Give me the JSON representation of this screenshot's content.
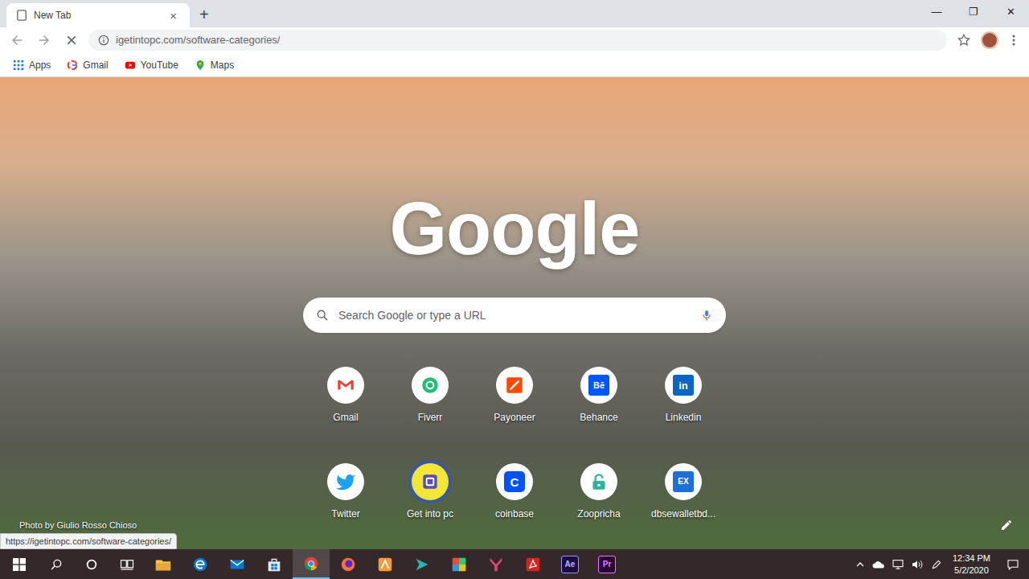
{
  "browser": {
    "tabs": [
      {
        "title": "New Tab",
        "selected": true
      }
    ],
    "tab_close": "×",
    "new_tab": "+",
    "window_controls": [
      "—",
      "❐",
      "✕"
    ]
  },
  "toolbar": {
    "url": "igetintopc.com/software-categories/",
    "loading": true
  },
  "bookmarks": [
    {
      "label": "Apps",
      "kind": "apps"
    },
    {
      "label": "Gmail",
      "kind": "google"
    },
    {
      "label": "YouTube",
      "kind": "youtube"
    },
    {
      "label": "Maps",
      "kind": "maps"
    }
  ],
  "ntp": {
    "logo": "Google",
    "search_placeholder": "Search Google or type a URL",
    "shortcuts": [
      {
        "label": "Gmail",
        "kind": "gmail",
        "hovered": false
      },
      {
        "label": "Fiverr",
        "kind": "fiverr",
        "hovered": false
      },
      {
        "label": "Payoneer",
        "kind": "payoneer",
        "hovered": false
      },
      {
        "label": "Behance",
        "kind": "behance",
        "glyph": "Bē",
        "hovered": false
      },
      {
        "label": "Linkedin",
        "kind": "linkedin",
        "glyph": "in",
        "hovered": false
      },
      {
        "label": "Twitter",
        "kind": "twitter",
        "hovered": false
      },
      {
        "label": "Get into pc",
        "kind": "getintopc",
        "hovered": true
      },
      {
        "label": "coinbase",
        "kind": "coinbase",
        "glyph": "C",
        "hovered": false
      },
      {
        "label": "Zoopricha",
        "kind": "lock",
        "hovered": false
      },
      {
        "label": "dbsewalletbd...",
        "kind": "ex",
        "glyph": "EX",
        "hovered": false
      }
    ],
    "attribution": "Photo by Giulio Rosso Chioso"
  },
  "status_url": "https://igetintopc.com/software-categories/",
  "taskbar": {
    "apps": [
      {
        "kind": "explorer",
        "active": false
      },
      {
        "kind": "edge",
        "active": false
      },
      {
        "kind": "mail",
        "active": false
      },
      {
        "kind": "store",
        "active": false
      },
      {
        "kind": "chrome",
        "active": true
      },
      {
        "kind": "firefox",
        "active": false
      },
      {
        "kind": "vector",
        "active": false
      },
      {
        "kind": "arrow",
        "active": false
      },
      {
        "kind": "palette",
        "active": false
      },
      {
        "kind": "yapp",
        "active": false
      },
      {
        "kind": "acrobat",
        "active": false
      },
      {
        "kind": "ae",
        "glyph": "Ae",
        "active": false
      },
      {
        "kind": "pr",
        "glyph": "Pr",
        "active": false
      }
    ],
    "time": "12:34 PM",
    "date": "5/2/2020"
  }
}
